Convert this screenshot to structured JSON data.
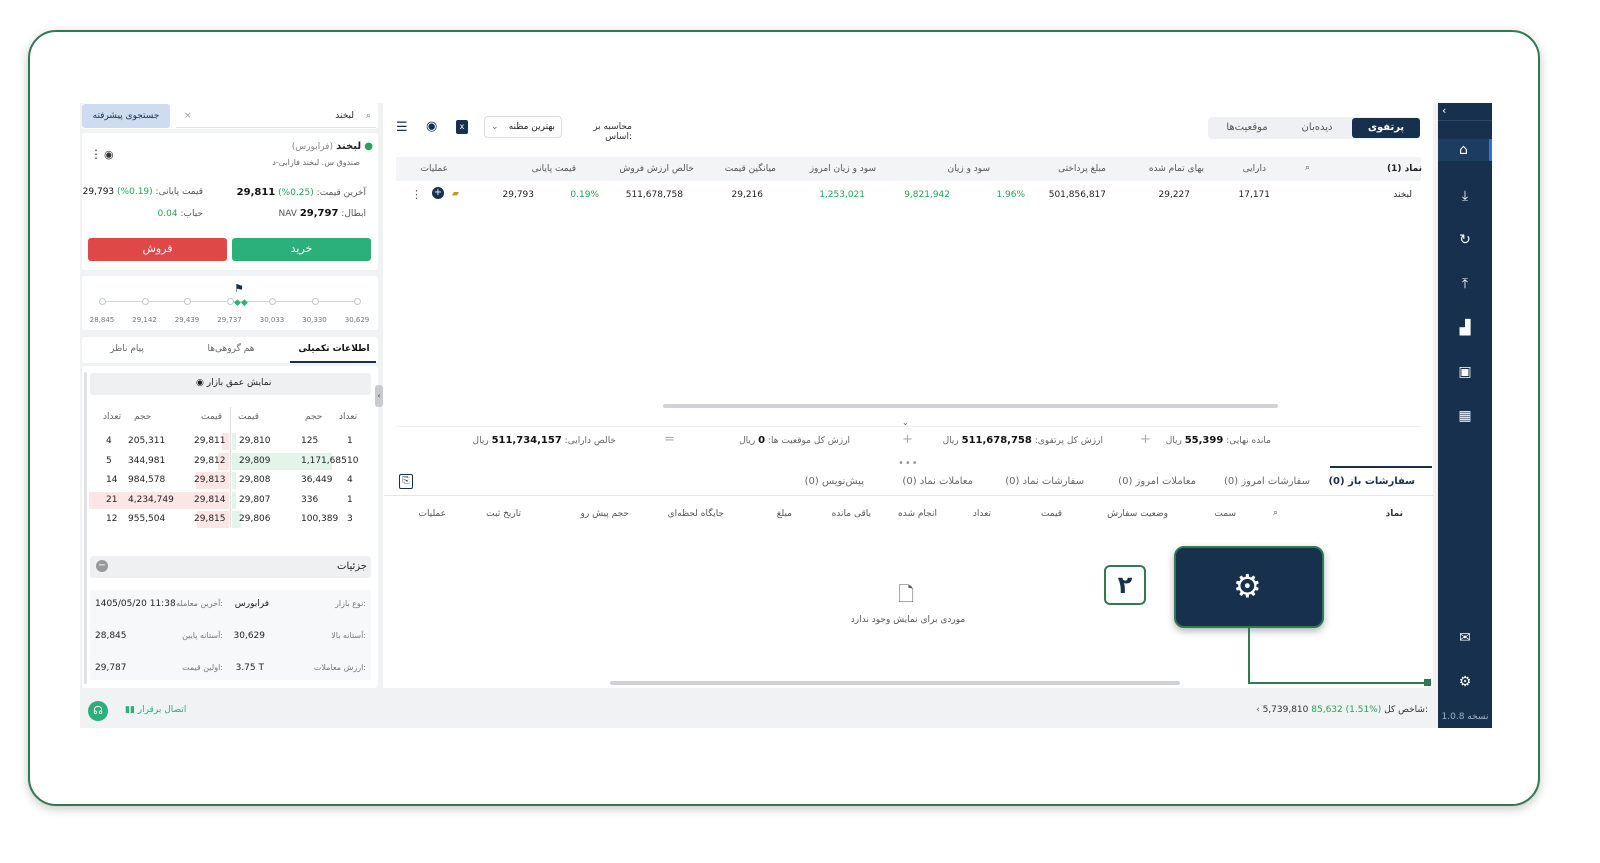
{
  "rail": {
    "version": "نسخه 1.0.8"
  },
  "top_tabs": [
    "پرتفوی",
    "دیده‌بان",
    "موقعیت‌ها"
  ],
  "calc": {
    "label": "محاسبه بر اساس:",
    "value": "بهترین مظنه"
  },
  "portfolio_table": {
    "headers": [
      "نماد (1)",
      "دارایی",
      "بهای تمام شده",
      "مبلغ پرداختی",
      "سود و زیان",
      "سود و زیان امروز",
      "میانگین قیمت",
      "خالص ارزش فروش",
      "قیمت پایانی",
      "عملیات"
    ],
    "row": {
      "symbol": "لبخند",
      "asset": "17,171",
      "cost": "29,227",
      "paid": "501,856,817",
      "pl_pct": "1.96%",
      "pl": "9,821,942",
      "today_pl": "1,253,021",
      "avg": "29,216",
      "net_sell": "511,678,758",
      "close_pct": "0.19%",
      "close": "29,793"
    }
  },
  "summary": {
    "remain_label": "مانده نهایی:",
    "remain": "55,399",
    "remain_unit": "ریال",
    "portfolio_label": "ارزش کل پرتفوی:",
    "portfolio": "511,678,758",
    "portfolio_unit": "ریال",
    "positions_label": "ارزش کل موقعیت ها:",
    "positions": "0",
    "positions_unit": "ریال",
    "net_label": "خالص دارایی:",
    "net": "511,734,157",
    "net_unit": "ریال"
  },
  "order_tabs": [
    "سفارشات باز (0)",
    "سفارشات امروز (0)",
    "معاملات امروز (0)",
    "سفارشات نماد (0)",
    "معاملات نماد (0)",
    "پیش‌نویس (0)"
  ],
  "order_headers": [
    "نماد",
    "سمت",
    "وضعیت سفارش",
    "قیمت",
    "تعداد",
    "انجام شده",
    "باقی مانده",
    "مبلغ",
    "جایگاه لحظه‌ای",
    "حجم پیش رو",
    "تاریخ ثبت",
    "عملیات"
  ],
  "empty_text": "موردی برای نمایش وجود ندارد",
  "callout_number": "۲",
  "search": {
    "value": "لبخند",
    "advanced": "جستجوی پیشرفته"
  },
  "symbol": {
    "name": "لبخند",
    "tag": "(فرابورس)",
    "full": "صندوق س. لبخند فارابی-د",
    "last_label": "آخرین قیمت:",
    "last": "29,811",
    "last_pct": "(0.25%)",
    "close_label": "قیمت پایانی:",
    "close": "29,793",
    "close_pct": "(0.19%)",
    "nav_label": "NAV ابطال:",
    "nav": "29,797",
    "bubble_label": "حباب:",
    "bubble": "0.04",
    "buy": "خرید",
    "sell": "فروش"
  },
  "range_ticks": [
    "28,845",
    "29,142",
    "29,439",
    "29,737",
    "30,033",
    "30,330",
    "30,629"
  ],
  "info_tabs": [
    "اطلاعات تکمیلی",
    "هم گروهی‌ها",
    "پیام ناظر"
  ],
  "depth": {
    "toggle": "نمایش عمق بازار",
    "headers_buy": [
      "تعداد",
      "حجم",
      "قیمت"
    ],
    "headers_sell": [
      "قیمت",
      "حجم",
      "تعداد"
    ],
    "rows": [
      {
        "bc": "1",
        "bv": "125",
        "bp": "29,810",
        "sp": "29,811",
        "sv": "205,311",
        "sc": "4"
      },
      {
        "bc": "10",
        "bv": "1,171,685",
        "bp": "29,809",
        "sp": "29,812",
        "sv": "344,981",
        "sc": "5"
      },
      {
        "bc": "4",
        "bv": "36,449",
        "bp": "29,808",
        "sp": "29,813",
        "sv": "984,578",
        "sc": "14"
      },
      {
        "bc": "1",
        "bv": "336",
        "bp": "29,807",
        "sp": "29,814",
        "sv": "4,234,749",
        "sc": "21"
      },
      {
        "bc": "3",
        "bv": "100,389",
        "bp": "29,806",
        "sp": "29,815",
        "sv": "955,504",
        "sc": "12"
      }
    ]
  },
  "details": {
    "title": "جزئیات",
    "market_type_label": "نوع بازار:",
    "market_type": "فرابورس",
    "last_trade_label": "آخرین معامله:",
    "last_trade": "1405/05/20 11:38",
    "upper_label": "آستانه بالا:",
    "upper": "30,629",
    "lower_label": "آستانه پایین:",
    "lower": "28,845",
    "value_label": "ارزش معاملات:",
    "value": "3.75 T",
    "first_label": "اولین قیمت:",
    "first": "29,787"
  },
  "status": {
    "index_label": "شاخص کل:",
    "index": "5,739,810",
    "index_change": "85,632 (1.51%)",
    "connection": "اتصال برقرار"
  }
}
